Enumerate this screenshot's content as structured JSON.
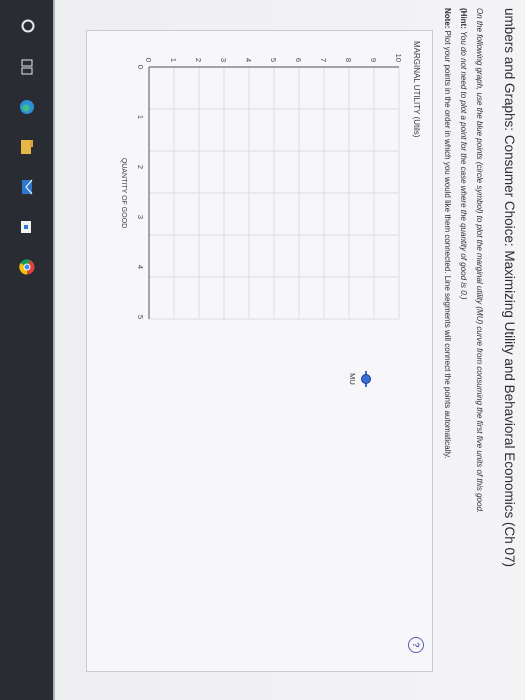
{
  "header": {
    "title": "umbers and Graphs: Consumer Choice: Maximizing Utility and Behavioral Economics (Ch 07)"
  },
  "instructions": {
    "line1": "On the following graph, use the blue points (circle symbol) to plot the marginal utility (MU) curve from consuming the first five units of this good.",
    "hint_label": "(Hint:",
    "hint_text": " You do not need to plot a point for the case where the quantity of good is 0.)",
    "note_label": "Note:",
    "note_text": " Plot your points in the order in which you would like them connected. Line segments will connect the points automatically."
  },
  "help": {
    "symbol": "?"
  },
  "graph": {
    "ylabel": "MARGINAL UTILITY (Utils)",
    "xlabel": "QUANTITY OF GOOD",
    "y_ticks": [
      "0",
      "1",
      "2",
      "3",
      "4",
      "5",
      "6",
      "7",
      "8",
      "9",
      "10"
    ],
    "x_ticks": [
      "0",
      "1",
      "2",
      "3",
      "4",
      "5"
    ],
    "legend_label": "MU",
    "series_color": "#3b6bd6"
  },
  "taskbar": {
    "icons": [
      "search-icon",
      "task-view-icon",
      "edge-icon",
      "file-explorer-icon",
      "mail-icon",
      "store-icon",
      "chrome-icon"
    ]
  }
}
